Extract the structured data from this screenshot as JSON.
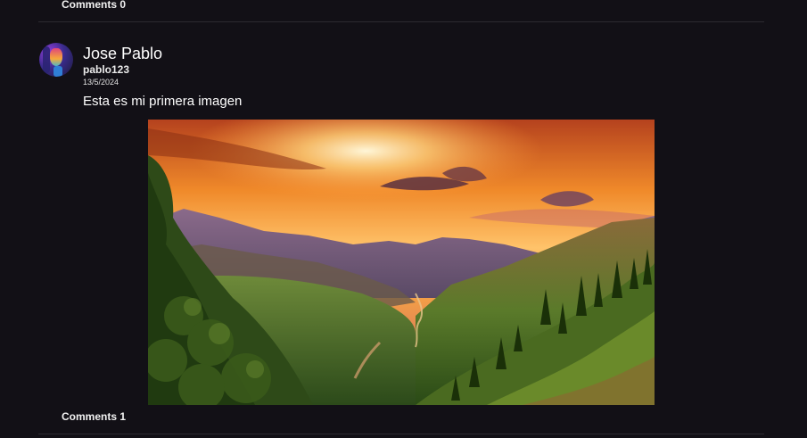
{
  "previous_post": {
    "comments_label": "Comments 0"
  },
  "post": {
    "author": {
      "name": "Jose Pablo",
      "username": "pablo123",
      "avatar_icon": "profile-avatar"
    },
    "date": "13/5/2024",
    "text": "Esta es mi primera imagen",
    "image": {
      "subject": "sunset-over-mountain-valley-photo"
    },
    "comments_label": "Comments 1"
  },
  "colors": {
    "background": "#121016",
    "divider": "#2c2a30",
    "text": "#ffffff"
  }
}
